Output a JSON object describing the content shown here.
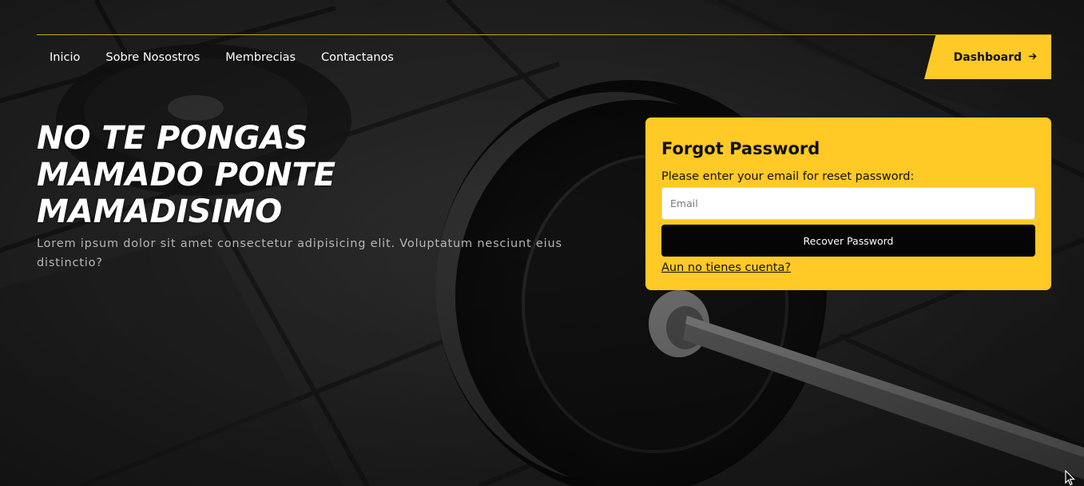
{
  "nav": {
    "items": [
      {
        "label": "Inicio"
      },
      {
        "label": "Sobre Nosostros"
      },
      {
        "label": "Membrecias"
      },
      {
        "label": "Contactanos"
      }
    ],
    "dashboard_label": "Dashboard",
    "dashboard_icon": "arrow-right-icon"
  },
  "hero": {
    "title_line1": "NO TE PONGAS",
    "title_line2": "MAMADO PONTE",
    "title_line3": "MAMADISIMO",
    "description": "Lorem ipsum dolor sit amet consectetur adipisicing elit. Voluptatum nesciunt eius distinctio?"
  },
  "forgot_card": {
    "title": "Forgot Password",
    "instruction": "Please enter your email for reset password:",
    "email_placeholder": "Email",
    "email_value": "",
    "submit_label": "Recover Password",
    "register_link": "Aun no tienes cuenta?"
  },
  "colors": {
    "accent": "#ffc926",
    "button_dark": "#050505",
    "nav_line": "#c9a21f"
  }
}
